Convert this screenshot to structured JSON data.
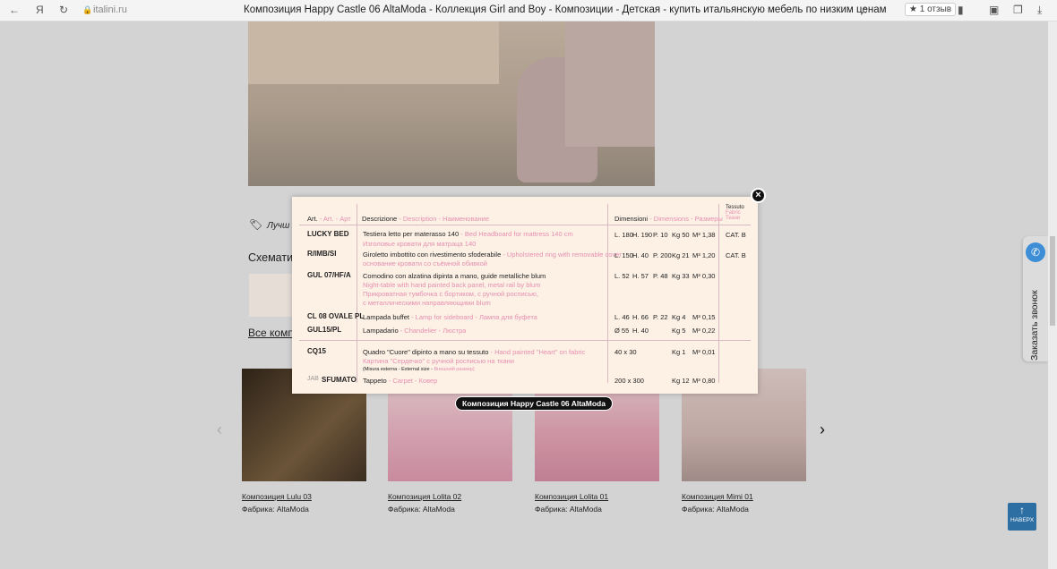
{
  "browser": {
    "domain": "italini.ru",
    "title": "Композиция Happy Castle 06 AltaModa - Коллекция Girl and Boy - Композиции - Детская - купить итальянскую мебель по низким ценам",
    "review": "1 отзыв"
  },
  "page": {
    "best_price": "Лучш",
    "schematic": "Схемати",
    "all_comp": "Все комп"
  },
  "modal": {
    "headers": {
      "art": "Art.",
      "art_en": "- Art. - Арт",
      "desc": "Descrizione",
      "desc_en": "- Description - Наименование",
      "dim": "Dimensioni",
      "dim_en": "- Dimensions - Размеры",
      "fabric": "Tessuto",
      "fabric_en": "Fabric",
      "fabric_ru": "Ткани"
    },
    "rows": [
      {
        "art": "LUCKY BED",
        "it": "Testiera letto per materasso 140",
        "en": "- Bed Headboard for mattress 140 cm",
        "ru": "Изголовье кровати для матраца 140",
        "l": "L. 180",
        "h": "H. 190",
        "pd": "P. 10",
        "kg": "Kg 50",
        "m": "M³ 1,38",
        "cat": "CAT. B"
      },
      {
        "art": "R/IMB/SI",
        "it": "Giroletto imbottito con rivestimento sfoderabile",
        "en": "- Upholstered ring with removable cover",
        "ru": "основание кровати со съёмной обивкой",
        "l": "L. 150",
        "h": "H. 40",
        "pd": "P. 200",
        "kg": "Kg 21",
        "m": "M³ 1,20",
        "cat": "CAT. B"
      },
      {
        "art": "GUL 07/HF/A",
        "it": "Comodino con alzatina dipinta a mano, guide metalliche blum",
        "en": "Night-table with hand painted back panel, metal rail by blum",
        "ru": "Прикроватная тумбочка с бортиком, с ручной росписью,",
        "ru2": "с металлическими направляющими blum",
        "l": "L. 52",
        "h": "H. 57",
        "pd": "P. 48",
        "kg": "Kg 33",
        "m": "M³ 0,30"
      },
      {
        "art": "CL 08 OVALE PL",
        "it": "Lampada buffet",
        "en": "- Lamp for sideboard - Лампа для буфета",
        "l": "L. 46",
        "h": "H. 66",
        "pd": "P. 22",
        "kg": "Kg 4",
        "m": "M³ 0,15"
      },
      {
        "art": "GUL15/PL",
        "it": "Lampadario",
        "en": "- Chandelier - Люстра",
        "l": "Ø 55",
        "h": "H. 40",
        "kg": "Kg 5",
        "m": "M³ 0,22"
      },
      {
        "art": "CQ15",
        "it": "Quadro \"Cuore\" dipinto a mano su tessuto",
        "en": "- Hand painted \"Heart\" on fabric",
        "ru": "Картина \"Сердечко\" с ручной росписью на ткани",
        "note": "(Misura esterna - External size -",
        "note_ru": "Внешний размер)",
        "l": "40 x 30",
        "kg": "Kg 1",
        "m": "M³ 0,01"
      },
      {
        "art": "SFUMATO",
        "prefix": "JAB",
        "it": "Tappeto",
        "en": "- Carpet - Ковер",
        "l": "200 x 300",
        "kg": "Kg 12",
        "m": "M³ 0,80"
      }
    ],
    "caption": "Композиция Happy Castle 06 AltaModa"
  },
  "carousel": [
    {
      "name": "Композиция Lulu 03",
      "factory": "Фабрика: AltaModa",
      "color": "#4a3a2c"
    },
    {
      "name": "Композиция Lolita 02",
      "factory": "Фабрика: AltaModa",
      "color": "#d9aab5"
    },
    {
      "name": "Композиция Lolita 01",
      "factory": "Фабрика: AltaModa",
      "color": "#cf9aa8"
    },
    {
      "name": "Композиция Mimi 01",
      "factory": "Фабрика: AltaModa",
      "color": "#c7b2ae"
    }
  ],
  "callback": "Заказать звонок",
  "to_top": "НАВЕРХ"
}
